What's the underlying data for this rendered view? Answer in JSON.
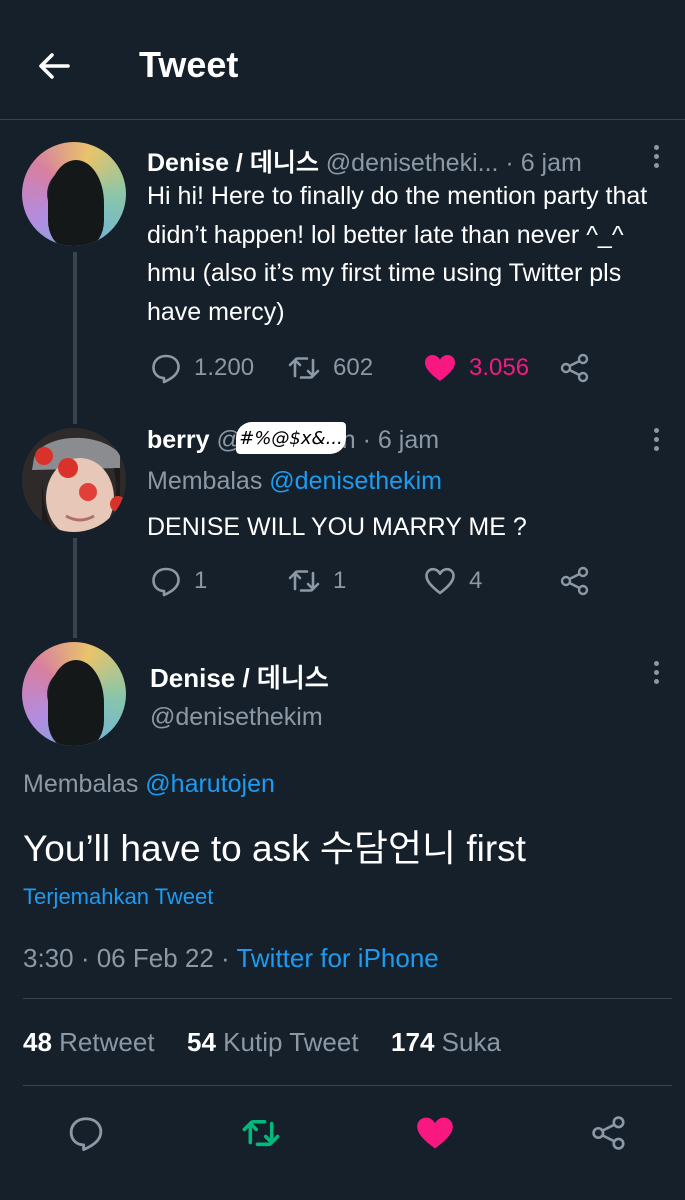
{
  "header": {
    "title": "Tweet"
  },
  "tweet1": {
    "name": "Denise / 데니스",
    "handle": "@denisetheki...",
    "separator": " · ",
    "time": "6 jam",
    "text": "Hi hi! Here to finally do the mention party that didn’t happen! lol better late than never ^_^ hmu (also it’s my first time using Twitter pls have mercy)",
    "replies": "1.200",
    "retweets": "602",
    "likes": "3.056",
    "liked": true
  },
  "tweet2": {
    "name": "berry",
    "handle_partial": "@",
    "handle_tail": "en",
    "censor": "#%@$x&...",
    "separator": " · ",
    "time": "6 jam",
    "reply_prefix": "Membalas",
    "reply_to": "@denisethekim",
    "text": "DENISE WILL YOU MARRY ME ?",
    "replies": "1",
    "retweets": "1",
    "likes": "4"
  },
  "main_tweet": {
    "name": "Denise / 데니스",
    "handle": "@denisethekim",
    "reply_prefix": "Membalas",
    "reply_to": "@harutojen",
    "text": "You’ll have to ask 수담언니 first",
    "translate": "Terjemahkan Tweet",
    "time": "3:30",
    "date": "06 Feb 22",
    "dot": " · ",
    "source": "Twitter for iPhone"
  },
  "stats": {
    "retweets_count": "48",
    "retweets_label": "Retweet",
    "quotes_count": "54",
    "quotes_label": "Kutip Tweet",
    "likes_count": "174",
    "likes_label": "Suka"
  },
  "colors": {
    "background": "#15202b",
    "divider": "#38444d",
    "muted": "#8b98a5",
    "link": "#1d9bf0",
    "like": "#f91880",
    "retweet": "#00ba7c"
  }
}
